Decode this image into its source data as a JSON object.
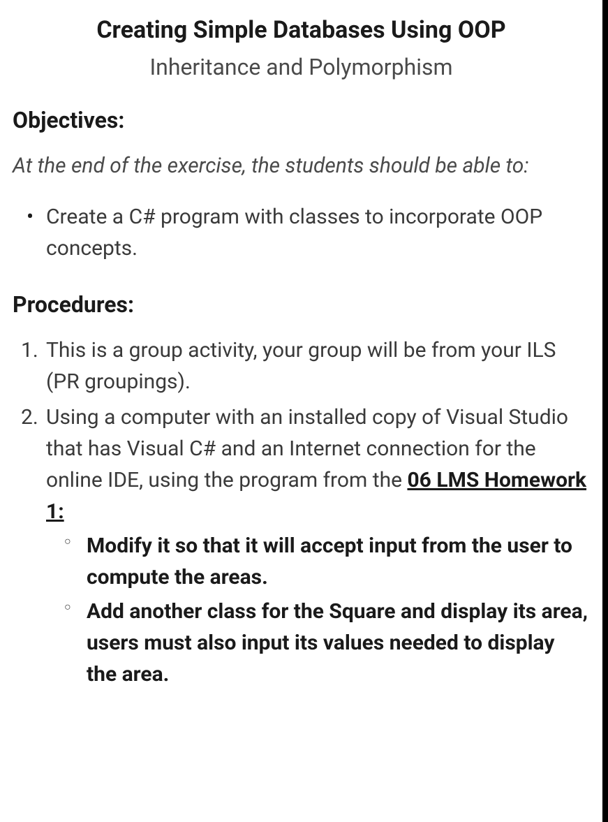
{
  "title": "Creating Simple Databases Using OOP",
  "subtitle": "Inheritance and Polymorphism",
  "objectives": {
    "heading": "Objectives:",
    "intro": "At the end of the exercise, the students should be able to:",
    "items": [
      "Create a C# program with classes to incorporate OOP concepts."
    ]
  },
  "procedures": {
    "heading": "Procedures:",
    "items": [
      {
        "text": "This is a group activity, your group will be from your ILS (PR groupings)."
      },
      {
        "text_before": "Using a computer with an installed copy of Visual Studio that has Visual C# and an Internet connection for the online IDE, using the program from the ",
        "link_text": "06 LMS Homework 1:",
        "sub_items": [
          "Modify it so that it will accept input from the user to compute the areas.",
          "Add another class for the Square and display its area, users must also input its values needed to display the area."
        ]
      }
    ]
  }
}
